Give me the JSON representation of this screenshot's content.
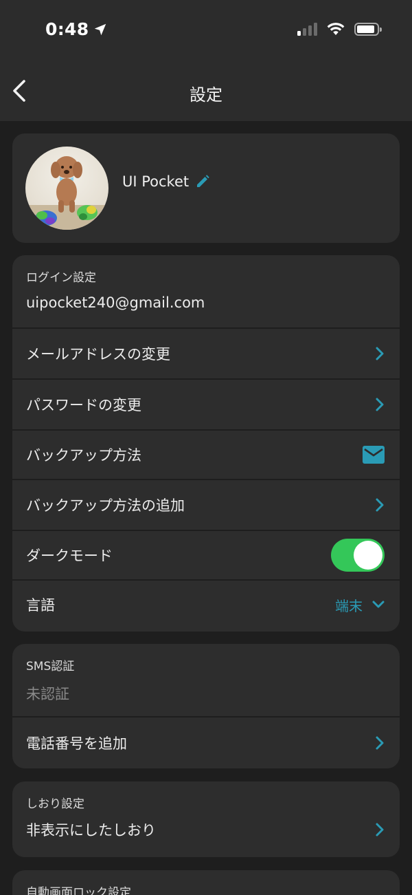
{
  "status_bar": {
    "time": "0:48",
    "signal_bars": 1,
    "battery_level": 0.8
  },
  "header": {
    "title": "設定"
  },
  "profile": {
    "name": "UI Pocket"
  },
  "login_settings": {
    "label": "ログイン設定",
    "email": "uipocket240@gmail.com",
    "items": [
      {
        "label": "メールアドレスの変更"
      },
      {
        "label": "パスワードの変更"
      },
      {
        "label": "バックアップ方法"
      },
      {
        "label": "バックアップ方法の追加"
      },
      {
        "label": "ダークモード",
        "on": true
      },
      {
        "label": "言語",
        "value": "端末"
      }
    ]
  },
  "sms": {
    "label": "SMS認証",
    "status": "未認証",
    "add_phone": "電話番号を追加"
  },
  "bookmark": {
    "label": "しおり設定",
    "hidden": "非表示にしたしおり"
  },
  "autolock": {
    "label": "自動画面ロック設定"
  },
  "colors": {
    "accent": "#2a9bb5",
    "toggle_on": "#34c759",
    "card": "#2d2d2d",
    "background": "#1e1e1e"
  }
}
